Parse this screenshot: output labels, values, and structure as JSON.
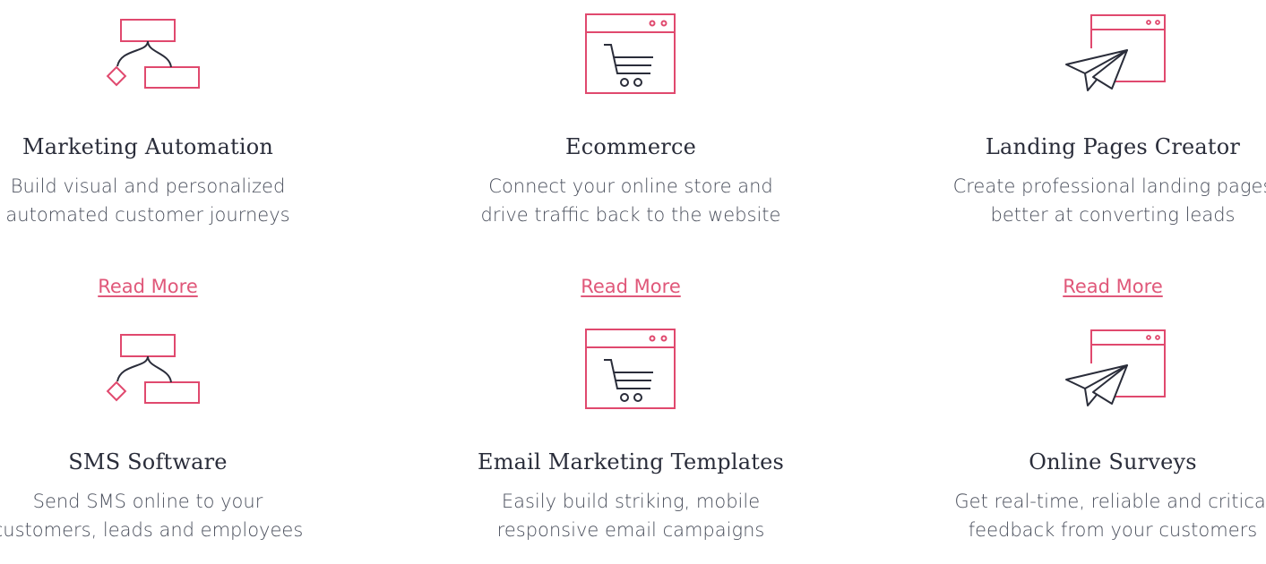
{
  "features": [
    {
      "icon": "workflow-icon",
      "title": "Marketing Automation",
      "description": [
        "Build visual and personalized",
        "automated customer journeys"
      ],
      "link": "Read More"
    },
    {
      "icon": "shopping-cart-window-icon",
      "title": "Ecommerce",
      "description": [
        "Connect your online store and",
        "drive traffic back to the website"
      ],
      "link": "Read More"
    },
    {
      "icon": "paper-plane-window-icon",
      "title": "Landing Pages Creator",
      "description": [
        "Create professional landing pages",
        "better at converting leads"
      ],
      "link": "Read More"
    },
    {
      "icon": "workflow-icon",
      "title": "SMS Software",
      "description": [
        "Send SMS online to your",
        "customers, leads and employees"
      ]
    },
    {
      "icon": "shopping-cart-window-icon",
      "title": "Email Marketing Templates",
      "description": [
        "Easily build striking, mobile",
        "responsive email campaigns"
      ]
    },
    {
      "icon": "paper-plane-window-icon",
      "title": "Online Surveys",
      "description": [
        "Get real-time, reliable and critical",
        "feedback from your customers"
      ]
    }
  ],
  "colors": {
    "accent": "#e0496e",
    "dark": "#2a2d3a",
    "link": "#e0587a"
  }
}
